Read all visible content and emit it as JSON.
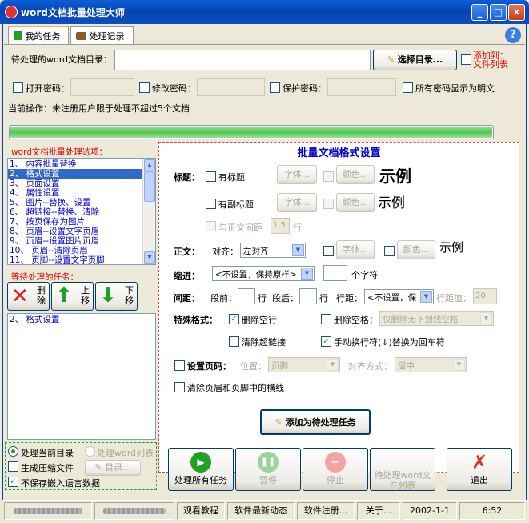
{
  "window": {
    "title": "word文档批量处理大师",
    "min": "_",
    "max": "□",
    "close": "×"
  },
  "tabs": [
    {
      "label": "我的任务"
    },
    {
      "label": "处理记录"
    }
  ],
  "help_icon": "?",
  "doc_dir": {
    "label": "待处理的word文档目录：",
    "value": "",
    "select_btn": "选择目录...",
    "add_to_list": "添加到：",
    "add_to_list2": "文件列表"
  },
  "passwords": {
    "open": "打开密码：",
    "modify": "修改密码：",
    "protect": "保护密码：",
    "show_plain": "所有密码显示为明文"
  },
  "current_op": {
    "label": "当前操作：",
    "value": "未注册用户限于处理不超过5个文档"
  },
  "progress": {
    "value": 100
  },
  "options": {
    "title": "word文档批量处理选项：",
    "items": [
      "1、 内容批量替换",
      "2、 格式设置",
      "3、 页面设置",
      "4、 属性设置",
      "5、 图片--替换、设置",
      "6、 超链接--替换、清除",
      "7、 按页保存为图片",
      "8、 页眉--设置文字页眉",
      "9、 页眉--设置图片页眉",
      "10、 页眉--清除页眉",
      "11、 页脚--设置文字页脚"
    ],
    "selected_index": 1
  },
  "pending": {
    "title": "等待处理的任务：",
    "delete": "删除",
    "up": "上移",
    "down": "下移",
    "items": [
      "2、 格式设置"
    ]
  },
  "process_opts": {
    "current_dir": "处理当前目录",
    "word_list": "处理word列表",
    "gen_zip": "生成压缩文件",
    "dir_btn": "目录...",
    "no_embed_lang": "不保存嵌入语言数据"
  },
  "format": {
    "title": "批量文档格式设置",
    "heading": {
      "label": "标题：",
      "has_title": "有标题",
      "has_subtitle": "有副标题",
      "font": "字体...",
      "color": "颜色...",
      "sample": "示例",
      "spacing_label": "与正文间距",
      "spacing_value": "1.5",
      "spacing_unit": "行"
    },
    "body": {
      "label": "正文：",
      "align_label": "对齐：",
      "align_value": "左对齐",
      "font": "字体...",
      "color": "颜色...",
      "sample": "示例"
    },
    "indent": {
      "label": "缩进：",
      "value": "<不设置，保持原样>",
      "chars_value": "",
      "chars_unit": "个字符"
    },
    "spacing": {
      "label": "间距：",
      "before": "段前：",
      "before_value": "",
      "after": "段后：",
      "after_value": "",
      "line_unit": "行",
      "line_label": "行距：",
      "line_value": "<不设置，保",
      "line_val_label": "行距值：",
      "line_val": "20"
    },
    "special": {
      "label": "特殊格式：",
      "delete_empty_lines": "删除空行",
      "delete_spaces": "删除空格：",
      "delete_spaces_opt": "仅删除无下划线空格",
      "clear_links": "清除超链接",
      "manual_break": "手动换行符(↓)替换为回车符"
    },
    "page_num": {
      "label": "设置页码：",
      "position_label": "位置：",
      "position_value": "页脚",
      "align_label": "对齐方式：",
      "align_value": "居中"
    },
    "clear_header_line": "清除页眉和页脚中的横线",
    "add_task_btn": "添加为待处理任务"
  },
  "actions": [
    {
      "label": "处理所有任务",
      "icon": "play-icon",
      "color": "#21a121"
    },
    {
      "label": "暂停",
      "icon": "pause-icon",
      "color": "#9ad49a"
    },
    {
      "label": "停止",
      "icon": "stop-icon",
      "color": "#f3a3a3"
    },
    {
      "label": "待处理word文件列表",
      "icon": "list-icon",
      "color": "#c8c8c8"
    },
    {
      "label": "退出",
      "icon": "exit-icon",
      "color": "#e03030"
    }
  ],
  "status": {
    "tutorial": "观看教程",
    "news": "软件最新动态",
    "register": "软件注册...",
    "about": "关于...",
    "date": "2002-1-1",
    "time": "6:52"
  }
}
